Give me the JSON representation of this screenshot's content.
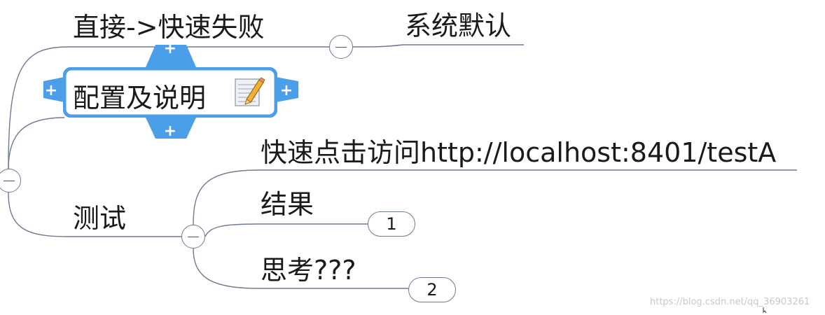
{
  "mindmap": {
    "nodes": {
      "zhijie": "直接->快速失败",
      "xitong": "系统默认",
      "peizhi": "配置及说明",
      "ceshi": "测试",
      "kuaisu": "快速点击访问http://localhost:8401/testA",
      "jieguo": "结果",
      "sikao": "思考???"
    },
    "badges": {
      "jieguo_count": "1",
      "sikao_count": "2"
    },
    "selected_node": "peizhi",
    "icons": {
      "note": "note-pencil-icon",
      "handle": "plus-handle-icon",
      "collapse": "collapse-minus-icon"
    }
  },
  "watermark": "https://blog.csdn.net/qq_36903261",
  "colors": {
    "line": "#6f7a8e",
    "selection": "#4b9fe8",
    "text": "#1a1a1a",
    "background": "#ffffff"
  }
}
